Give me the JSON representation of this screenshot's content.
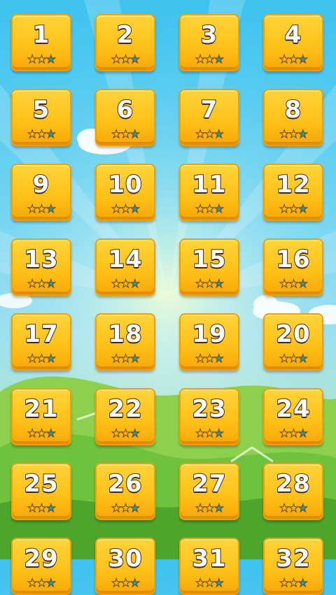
{
  "levels": [
    {
      "label": "1",
      "stars_earned": 2
    },
    {
      "label": "2",
      "stars_earned": 2
    },
    {
      "label": "3",
      "stars_earned": 2
    },
    {
      "label": "4",
      "stars_earned": 2
    },
    {
      "label": "5",
      "stars_earned": 2
    },
    {
      "label": "6",
      "stars_earned": 2
    },
    {
      "label": "7",
      "stars_earned": 2
    },
    {
      "label": "8",
      "stars_earned": 2
    },
    {
      "label": "9",
      "stars_earned": 2
    },
    {
      "label": "10",
      "stars_earned": 2
    },
    {
      "label": "11",
      "stars_earned": 2
    },
    {
      "label": "12",
      "stars_earned": 2
    },
    {
      "label": "13",
      "stars_earned": 2
    },
    {
      "label": "14",
      "stars_earned": 2
    },
    {
      "label": "15",
      "stars_earned": 2
    },
    {
      "label": "16",
      "stars_earned": 2
    },
    {
      "label": "17",
      "stars_earned": 2
    },
    {
      "label": "18",
      "stars_earned": 2
    },
    {
      "label": "19",
      "stars_earned": 2
    },
    {
      "label": "20",
      "stars_earned": 2
    },
    {
      "label": "21",
      "stars_earned": 2
    },
    {
      "label": "22",
      "stars_earned": 2
    },
    {
      "label": "23",
      "stars_earned": 2
    },
    {
      "label": "24",
      "stars_earned": 2
    },
    {
      "label": "25",
      "stars_earned": 2
    },
    {
      "label": "26",
      "stars_earned": 2
    },
    {
      "label": "27",
      "stars_earned": 2
    },
    {
      "label": "28",
      "stars_earned": 2
    },
    {
      "label": "29",
      "stars_earned": 2
    },
    {
      "label": "30",
      "stars_earned": 2
    },
    {
      "label": "31",
      "stars_earned": 2
    },
    {
      "label": "32",
      "stars_earned": 2
    }
  ],
  "stars_per_level": 3,
  "star_glyph": "★",
  "colors": {
    "tile": "#ffc21a",
    "star_earned": "#ffb81e",
    "star_empty": "#2d97a8"
  }
}
